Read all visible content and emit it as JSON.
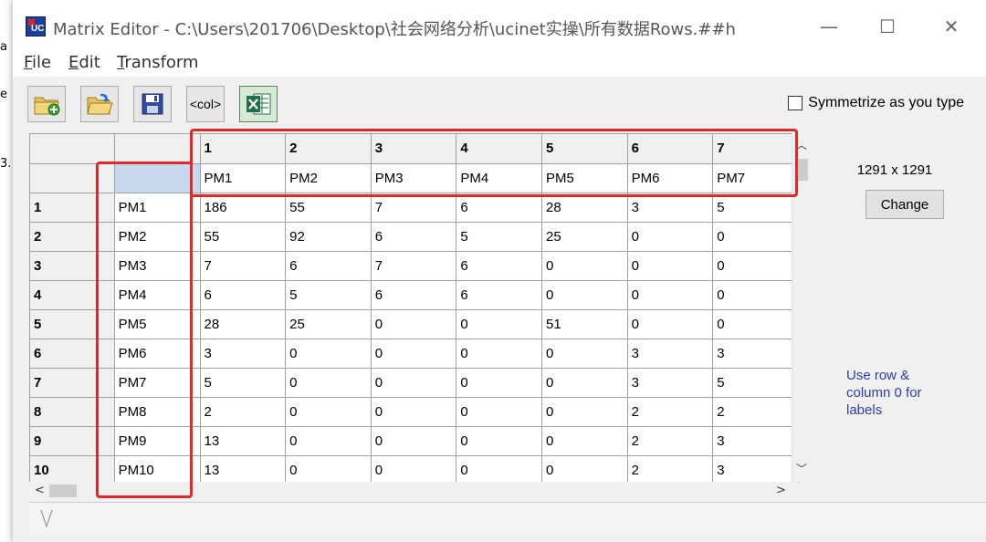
{
  "window": {
    "title": "Matrix Editor - C:\\Users\\201706\\Desktop\\社会网络分析\\ucinet实操\\所有数据Rows.##h",
    "controls": {
      "minimize": "—",
      "maximize": "☐",
      "close": "✕"
    }
  },
  "background_fragments": [
    "a",
    "e",
    "3."
  ],
  "menu": [
    {
      "key": "F",
      "rest": "ile"
    },
    {
      "key": "E",
      "rest": "dit"
    },
    {
      "key": "T",
      "rest": "ransform"
    }
  ],
  "toolbar": {
    "buttons": [
      {
        "name": "new-matrix-button",
        "icon": "folder-add-icon"
      },
      {
        "name": "open-button",
        "icon": "folder-open-icon"
      },
      {
        "name": "save-button",
        "icon": "floppy-disk-icon"
      },
      {
        "name": "col-button",
        "label": "<col>"
      },
      {
        "name": "excel-button",
        "icon": "excel-icon"
      }
    ],
    "symmetrize_label": "Symmetrize as you type",
    "symmetrize_checked": false
  },
  "grid": {
    "col_numbers": [
      "1",
      "2",
      "3",
      "4",
      "5",
      "6",
      "7"
    ],
    "col_labels": [
      "PM1",
      "PM2",
      "PM3",
      "PM4",
      "PM5",
      "PM6",
      "PM7"
    ],
    "rows": [
      {
        "num": "1",
        "label": "PM1",
        "values": [
          "186",
          "55",
          "7",
          "6",
          "28",
          "3",
          "5"
        ]
      },
      {
        "num": "2",
        "label": "PM2",
        "values": [
          "55",
          "92",
          "6",
          "5",
          "25",
          "0",
          "0"
        ]
      },
      {
        "num": "3",
        "label": "PM3",
        "values": [
          "7",
          "6",
          "7",
          "6",
          "0",
          "0",
          "0"
        ]
      },
      {
        "num": "4",
        "label": "PM4",
        "values": [
          "6",
          "5",
          "6",
          "6",
          "0",
          "0",
          "0"
        ]
      },
      {
        "num": "5",
        "label": "PM5",
        "values": [
          "28",
          "25",
          "0",
          "0",
          "51",
          "0",
          "0"
        ]
      },
      {
        "num": "6",
        "label": "PM6",
        "values": [
          "3",
          "0",
          "0",
          "0",
          "0",
          "3",
          "3"
        ]
      },
      {
        "num": "7",
        "label": "PM7",
        "values": [
          "5",
          "0",
          "0",
          "0",
          "0",
          "3",
          "5"
        ]
      },
      {
        "num": "8",
        "label": "PM8",
        "values": [
          "2",
          "0",
          "0",
          "0",
          "0",
          "2",
          "2"
        ]
      },
      {
        "num": "9",
        "label": "PM9",
        "values": [
          "13",
          "0",
          "0",
          "0",
          "0",
          "2",
          "3"
        ]
      },
      {
        "num": "10",
        "label": "PM10",
        "values": [
          "13",
          "0",
          "0",
          "0",
          "0",
          "2",
          "3"
        ]
      }
    ]
  },
  "side_panel": {
    "dimensions": "1291 x  1291",
    "change_label": "Change",
    "hint": "Use row & column 0 for labels"
  },
  "colors": {
    "highlight": "#e02a2a",
    "hint_text": "#2c3fa8",
    "selected_cell": "#c7d8ef"
  }
}
